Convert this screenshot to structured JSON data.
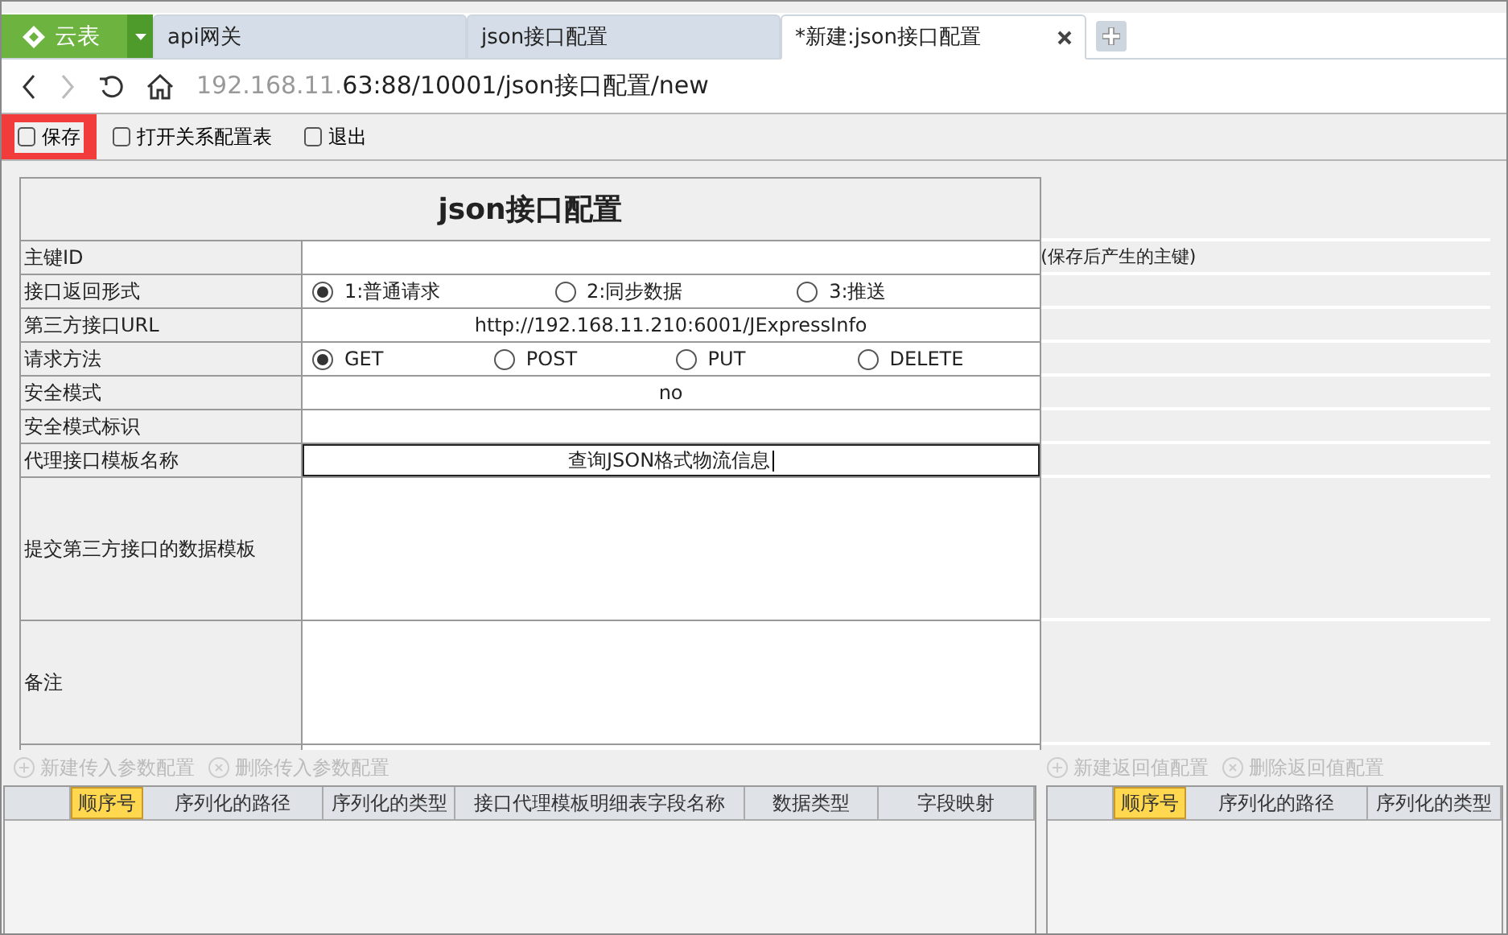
{
  "logo": {
    "label": "云表"
  },
  "tabs": [
    {
      "label": "api网关",
      "selected": false,
      "closable": false
    },
    {
      "label": "json接口配置",
      "selected": false,
      "closable": false
    },
    {
      "label": "*新建:json接口配置",
      "selected": true,
      "closable": true
    }
  ],
  "address": {
    "host": "192.168.11.",
    "path": "63:88/10001/json接口配置/new"
  },
  "toolbar": [
    {
      "label": "保存",
      "highlighted": true
    },
    {
      "label": "打开关系配置表",
      "highlighted": false
    },
    {
      "label": "退出",
      "highlighted": false
    }
  ],
  "form": {
    "title": "json接口配置",
    "rows": [
      {
        "label": "主键ID",
        "kind": "text",
        "value": "",
        "note": "(保存后产生的主键)"
      },
      {
        "label": "接口返回形式",
        "kind": "radio",
        "options": [
          {
            "label": "1:普通请求",
            "selected": true
          },
          {
            "label": "2:同步数据",
            "selected": false
          },
          {
            "label": "3:推送",
            "selected": false
          }
        ]
      },
      {
        "label": "第三方接口URL",
        "kind": "text",
        "value": "http://192.168.11.210:6001/JExpressInfo"
      },
      {
        "label": "请求方法",
        "kind": "radio",
        "options": [
          {
            "label": "GET",
            "selected": true
          },
          {
            "label": "POST",
            "selected": false
          },
          {
            "label": "PUT",
            "selected": false
          },
          {
            "label": "DELETE",
            "selected": false
          }
        ]
      },
      {
        "label": "安全模式",
        "kind": "text",
        "value": "no"
      },
      {
        "label": "安全模式标识",
        "kind": "text",
        "value": ""
      },
      {
        "label": "代理接口模板名称",
        "kind": "input",
        "value": "查询JSON格式物流信息"
      },
      {
        "label": "提交第三方接口的数据模板",
        "kind": "area",
        "value": ""
      },
      {
        "label": "备注",
        "kind": "area",
        "value": ""
      }
    ]
  },
  "param_panel": {
    "actions": [
      "新建传入参数配置",
      "删除传入参数配置"
    ],
    "columns": [
      {
        "label": "顺序号",
        "highlighted": true
      },
      {
        "label": "序列化的路径",
        "highlighted": false
      },
      {
        "label": "序列化的类型",
        "highlighted": false
      },
      {
        "label": "接口代理模板明细表字段名称",
        "highlighted": false
      },
      {
        "label": "数据类型",
        "highlighted": false
      },
      {
        "label": "字段映射",
        "highlighted": false
      }
    ]
  },
  "return_panel": {
    "actions": [
      "新建返回值配置",
      "删除返回值配置"
    ],
    "columns": [
      {
        "label": "顺序号",
        "highlighted": true
      },
      {
        "label": "序列化的路径",
        "highlighted": false
      },
      {
        "label": "序列化的类型",
        "highlighted": false
      }
    ]
  }
}
